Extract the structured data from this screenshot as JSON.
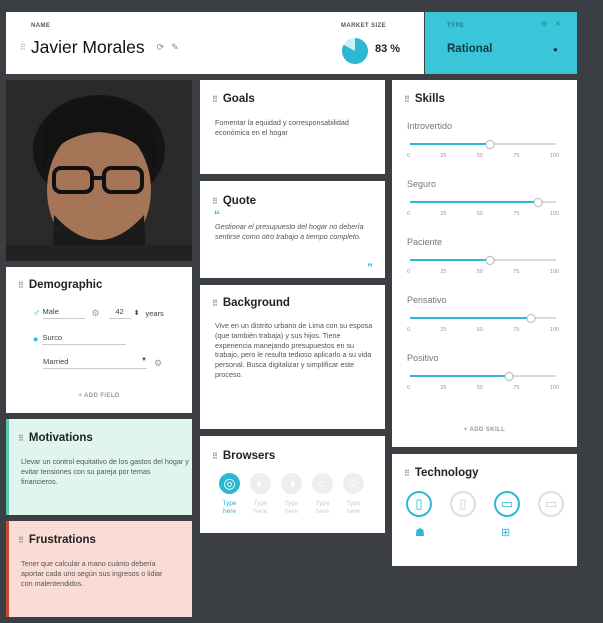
{
  "header": {
    "name_label": "NAME",
    "name": "Javier Morales",
    "market_label": "MARKET SIZE",
    "market_value": "83 %",
    "market_fraction": 0.83,
    "type_label": "TYPE",
    "type_value": "Rational"
  },
  "goals": {
    "title": "Goals",
    "text": "Fomentar la equidad y corresponsabilidad económica en el hogar"
  },
  "quote": {
    "title": "Quote",
    "text": "Gestionar el presupuesto del hogar no debería sentirse como otro trabajo a tiempo completo."
  },
  "background": {
    "title": "Background",
    "text": "Vive en un distrito urbano de Lima con su esposa (que también trabaja) y sus hijos. Tiene experiencia manejando presupuestos en su trabajo, pero le resulta tedioso aplicarlo a su vida personal. Busca digitalizar y simplificar este proceso."
  },
  "browsers": {
    "title": "Browsers",
    "items": [
      {
        "name": "chrome-icon",
        "label": "Type here",
        "active": true
      },
      {
        "name": "firefox-icon",
        "label": "Type here",
        "active": false
      },
      {
        "name": "edge-icon",
        "label": "Type here",
        "active": false
      },
      {
        "name": "opera-icon",
        "label": "Type here",
        "active": false
      },
      {
        "name": "safari-icon",
        "label": "Type here",
        "active": false
      }
    ]
  },
  "demographic": {
    "title": "Demographic",
    "gender": "Male",
    "age": "42",
    "age_unit": "years",
    "location": "Surco",
    "status": "Married",
    "add_field": "+ ADD FIELD"
  },
  "motivations": {
    "title": "Motivations",
    "text": "Llevar un control equitativo de los gastos del hogar y evitar tensiones con su pareja por temas financieros."
  },
  "frustrations": {
    "title": "Frustrations",
    "text": "Tener que calcular a mano cuánto debería aportar cada uno según sus ingresos o lidiar con malentendidos."
  },
  "skills": {
    "title": "Skills",
    "ticks": [
      "0",
      "25",
      "50",
      "75",
      "100"
    ],
    "items": [
      {
        "label": "Introvertido",
        "value": 55
      },
      {
        "label": "Seguro",
        "value": 88
      },
      {
        "label": "Paciente",
        "value": 55
      },
      {
        "label": "Pensativo",
        "value": 83
      },
      {
        "label": "Positivo",
        "value": 68
      }
    ],
    "add_skill": "+ ADD SKILL"
  },
  "technology": {
    "title": "Technology",
    "items": [
      {
        "name": "smartphone-icon",
        "active": true
      },
      {
        "name": "tablet-icon",
        "active": false
      },
      {
        "name": "laptop-icon",
        "active": true
      },
      {
        "name": "desktop-icon",
        "active": false
      }
    ],
    "os": [
      {
        "name": "android-icon"
      },
      {
        "name": "windows-icon"
      }
    ]
  },
  "colors": {
    "accent": "#2db8d2",
    "type_panel": "#3ac5d8",
    "motivations_bg": "#dff5ee",
    "motivations_bar": "#5ac8a4",
    "frustrations_bg": "#f9dcd5",
    "frustrations_bar": "#c94a35"
  }
}
